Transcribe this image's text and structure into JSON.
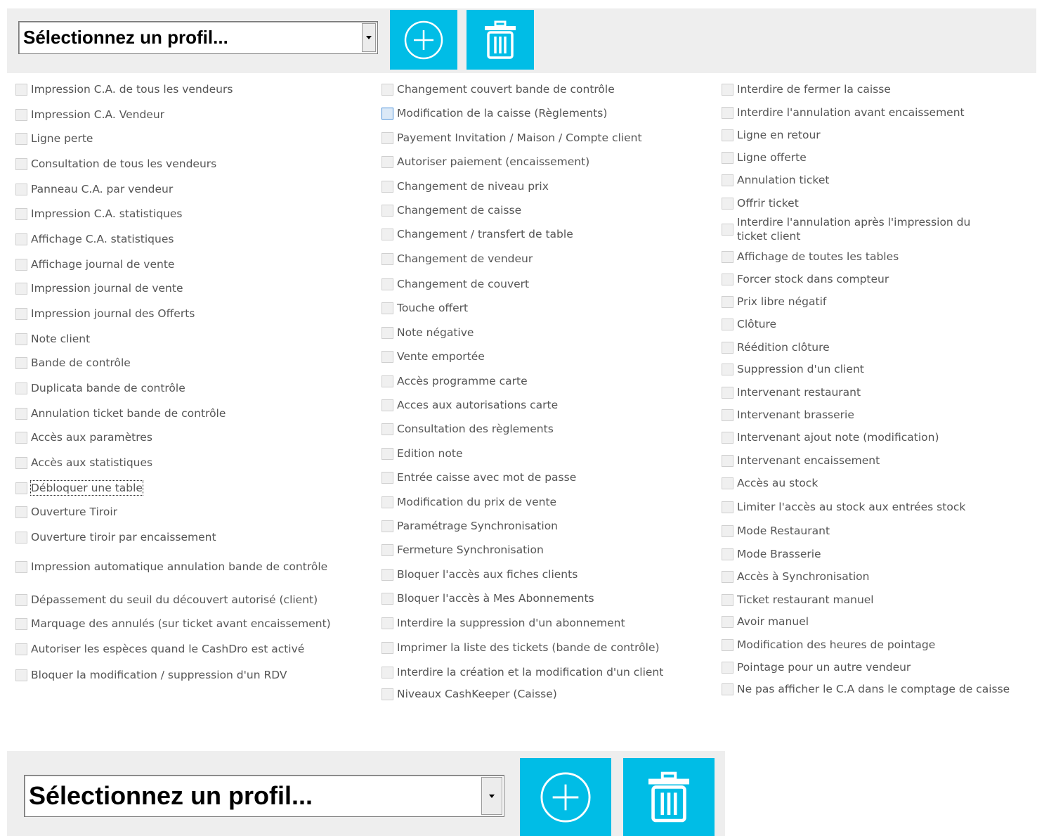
{
  "profile_select": {
    "placeholder": "Sélectionnez un profil..."
  },
  "icons": {
    "add": "plus-circle-icon",
    "delete": "trash-icon",
    "dropdown": "chevron-down-icon"
  },
  "colors": {
    "accent": "#00bde6",
    "toolbar_bg": "#eeeeee",
    "text": "#555555"
  },
  "column1": [
    "Impression C.A. de tous les vendeurs",
    "Impression C.A. Vendeur",
    "Ligne perte",
    "Consultation de tous les vendeurs",
    "Panneau C.A. par vendeur",
    "Impression C.A. statistiques",
    "Affichage C.A. statistiques",
    "Affichage journal de vente",
    "Impression journal de vente",
    "Impression journal des Offerts",
    "Note client",
    "Bande de contrôle",
    "Duplicata bande de contrôle",
    "Annulation ticket bande de contrôle",
    "Accès aux paramètres",
    "Accès aux statistiques",
    "Débloquer une table",
    "Ouverture Tiroir",
    "Ouverture tiroir par encaissement",
    "Impression automatique annulation bande de contrôle",
    "Dépassement du seuil du découvert autorisé (client)",
    "Marquage des annulés (sur ticket avant encaissement)",
    "Autoriser les espèces quand le CashDro est activé",
    "Bloquer la modification / suppression d'un RDV"
  ],
  "column2": [
    "Changement couvert bande de contrôle",
    "Modification de la caisse (Règlements)",
    "Payement Invitation / Maison / Compte client",
    "Autoriser paiement (encaissement)",
    "Changement de niveau prix",
    "Changement de caisse",
    "Changement / transfert de table",
    "Changement de vendeur",
    "Changement de couvert",
    "Touche offert",
    "Note négative",
    "Vente emportée",
    "Accès programme carte",
    "Acces aux autorisations carte",
    "Consultation des règlements",
    "Edition note",
    "Entrée caisse avec mot de passe",
    "Modification du prix de vente",
    "Paramétrage Synchronisation",
    "Fermeture Synchronisation",
    "Bloquer l'accès aux fiches clients",
    "Bloquer l'accès à Mes Abonnements",
    "Interdire la suppression d'un abonnement",
    "Imprimer la liste des tickets (bande de contrôle)",
    "Interdire la création et la modification d'un client",
    "Niveaux CashKeeper (Caisse)"
  ],
  "column3": [
    "Interdire de fermer la caisse",
    "Interdire l'annulation avant encaissement",
    "Ligne en retour",
    "Ligne offerte",
    "Annulation ticket",
    "Offrir ticket",
    "Interdire l'annulation après l'impression du ticket client",
    "Affichage de toutes les tables",
    "Forcer stock dans compteur",
    "Prix libre négatif",
    "Clôture",
    "Réédition clôture",
    "Suppression d'un client",
    "Intervenant restaurant",
    "Intervenant brasserie",
    "Intervenant ajout note (modification)",
    "Intervenant encaissement",
    "Accès au stock",
    "Limiter l'accès au stock aux entrées stock",
    "Mode Restaurant",
    "Mode Brasserie",
    "Accès à Synchronisation",
    "Ticket restaurant manuel",
    "Avoir manuel",
    "Modification des heures de pointage",
    "Pointage pour un autre vendeur",
    "Ne pas afficher le C.A dans le comptage de caisse"
  ]
}
